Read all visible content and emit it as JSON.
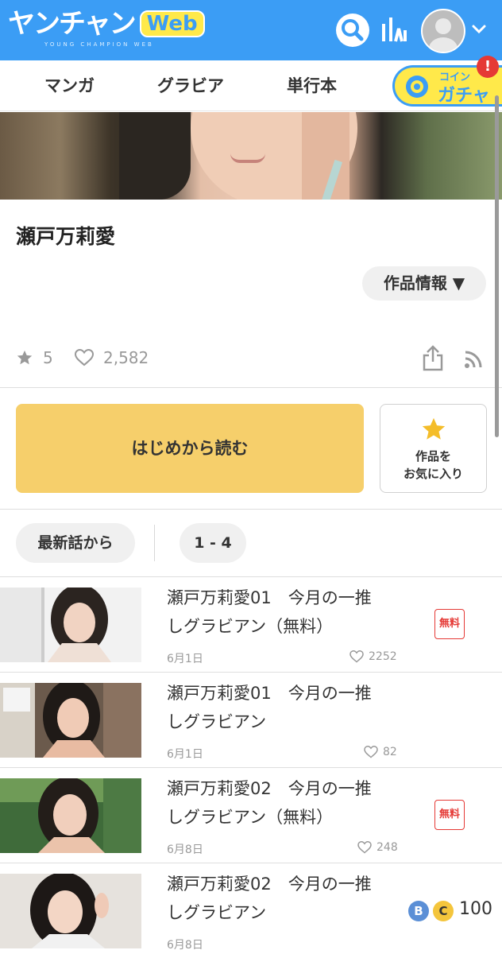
{
  "header": {
    "logo_main": "ヤンチャン",
    "logo_web": "Web",
    "logo_sub": "YOUNG CHAMPION WEB",
    "search_icon": "search-icon",
    "ranking_icon": "ranking-icon",
    "avatar_icon": "avatar-icon",
    "menu_icon": "chevron-down-icon"
  },
  "nav": {
    "tabs": [
      {
        "label": "マンガ"
      },
      {
        "label": "グラビア"
      },
      {
        "label": "単行本"
      }
    ],
    "gacha": {
      "coin_label": "コイン",
      "label": "ガチャ",
      "badge": "!"
    }
  },
  "work": {
    "title": "瀬戸万莉愛",
    "info_button": "作品情報 ▼",
    "rating": "5",
    "likes": "2,582"
  },
  "actions": {
    "read_button": "はじめから読む",
    "favorite_line1": "作品を",
    "favorite_line2": "お気に入り"
  },
  "filters": {
    "latest": "最新話から",
    "range": "1 - 4"
  },
  "episodes": [
    {
      "title_line1": "瀬戸万莉愛01　今月の一推",
      "title_line2": "しグラビアン（無料）",
      "date": "6月1日",
      "likes": "2252",
      "badge": "無料"
    },
    {
      "title_line1": "瀬戸万莉愛01　今月の一推",
      "title_line2": "しグラビアン",
      "date": "6月1日",
      "likes": "82"
    },
    {
      "title_line1": "瀬戸万莉愛02　今月の一推",
      "title_line2": "しグラビアン（無料）",
      "date": "6月8日",
      "likes": "248",
      "badge": "無料"
    },
    {
      "title_line1": "瀬戸万莉愛02　今月の一推",
      "title_line2": "しグラビアン",
      "date": "6月8日",
      "coin_b": "B",
      "coin_c": "C",
      "price": "100"
    }
  ],
  "colors": {
    "brand_blue": "#3b9df5",
    "accent_yellow": "#f6cf6b",
    "logo_yellow": "#ffe94a",
    "free_red": "#e53935"
  }
}
